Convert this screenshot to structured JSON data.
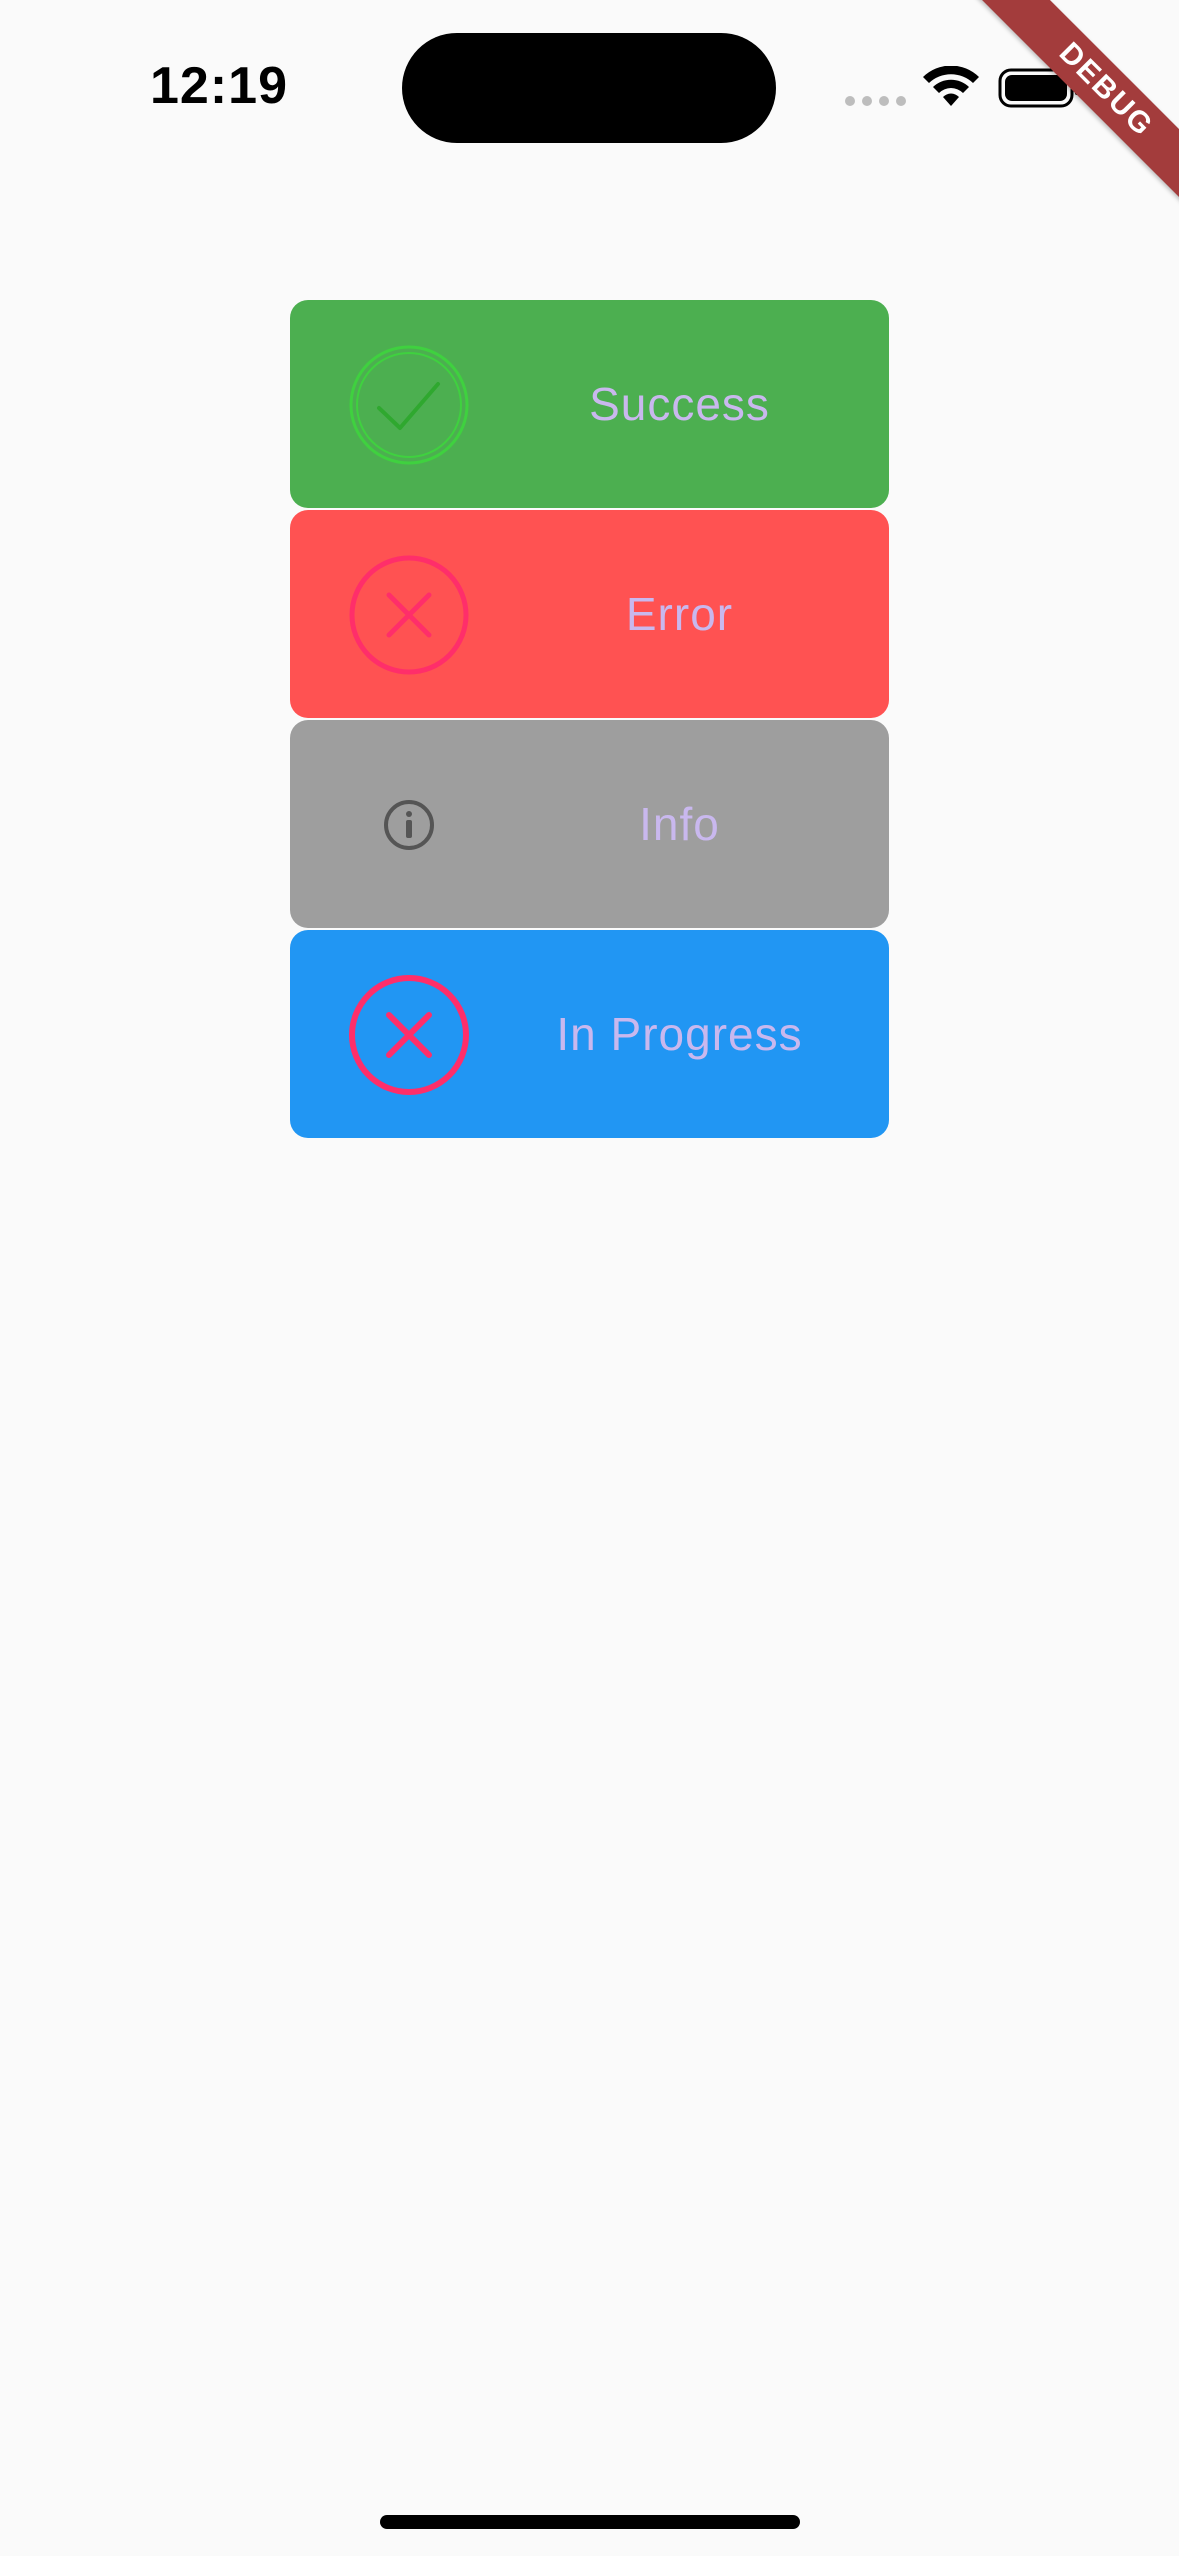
{
  "status_bar": {
    "time": "12:19"
  },
  "debug_banner": {
    "label": "DEBUG"
  },
  "cards": [
    {
      "label": "Success",
      "icon": "check-circle-icon",
      "background": "#4caf50",
      "icon_color": "#3fd13f"
    },
    {
      "label": "Error",
      "icon": "x-circle-icon",
      "background": "#ff5252",
      "icon_color": "#ff2e6a"
    },
    {
      "label": "Info",
      "icon": "info-circle-icon",
      "background": "#9e9e9e",
      "icon_color": "#555555"
    },
    {
      "label": "In Progress",
      "icon": "x-circle-icon",
      "background": "#2196f3",
      "icon_color": "#ff2e6a"
    }
  ],
  "colors": {
    "label_text": "#c9b8ee",
    "page_background": "#fafafa"
  }
}
